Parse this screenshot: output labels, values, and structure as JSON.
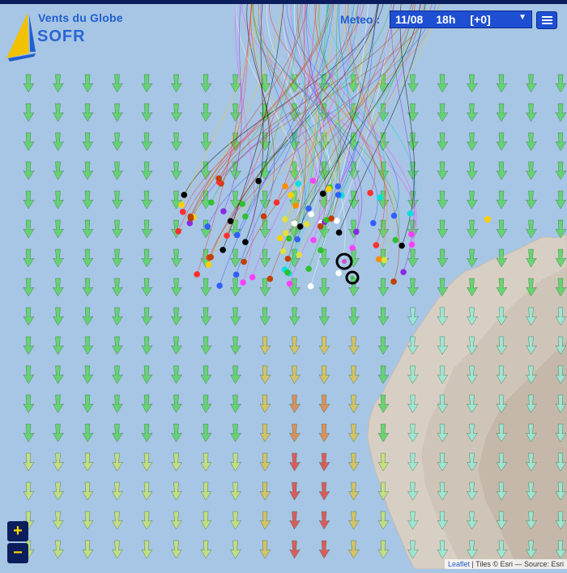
{
  "app": {
    "logo_title": "Vents du Globe",
    "logo_sub": "SOFR"
  },
  "meteo": {
    "label": "Meteo :",
    "date": "11/08",
    "hour": "18h",
    "offset": "[+0]"
  },
  "zoom": {
    "in": "+",
    "out": "−"
  },
  "attribution": {
    "leaflet": "Leaflet",
    "sep": " | Tiles © Esri — Source: Esri"
  },
  "colors": {
    "sea": "#a7c5e4",
    "land": "#d9d1c7",
    "ui_blue": "#1e4fd2",
    "dark_navy": "#0b1d5c",
    "zoom_text": "#ffd700"
  },
  "icons": {
    "menu": "hamburger-icon",
    "boat_marker": "circle-dot"
  },
  "map": {
    "map_type": "wind arrows over satellite sea chart",
    "wind_color_scale": "cyan (light) → green → yellow → orange → red (strong)",
    "boats_visible": true
  }
}
